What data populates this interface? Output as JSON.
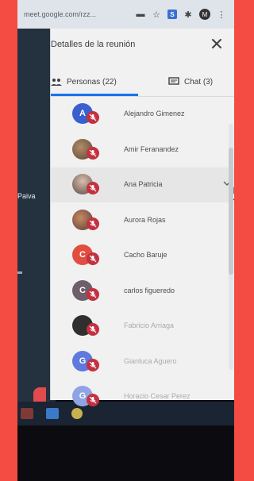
{
  "browser": {
    "url": "meet.google.com/rzz...",
    "extension_badge": "S",
    "profile_initial": "M"
  },
  "background": {
    "participant_label": "Paiva"
  },
  "panel": {
    "title": "Detalles de la reunión",
    "tabs": [
      {
        "label": "Personas (22)",
        "icon": "people-icon",
        "active": true
      },
      {
        "label": "Chat (3)",
        "icon": "chat-icon",
        "active": false
      }
    ],
    "people": [
      {
        "name": "Alejandro Gimenez",
        "initial": "A",
        "avatar_color": "#3a5fcf",
        "avatar_type": "initial",
        "muted": true
      },
      {
        "name": "Amir Feranandez",
        "initial": "",
        "avatar_color": "#8b6a4f",
        "avatar_type": "photo",
        "muted": true
      },
      {
        "name": "Ana Patricia",
        "initial": "",
        "avatar_color": "#c7b9b0",
        "avatar_type": "photo2",
        "muted": true,
        "hovered": true
      },
      {
        "name": "Aurora Rojas",
        "initial": "",
        "avatar_color": "#8a5a4a",
        "avatar_type": "photo3",
        "muted": true
      },
      {
        "name": "Cacho Baruje",
        "initial": "C",
        "avatar_color": "#e14e3f",
        "avatar_type": "initial",
        "muted": true
      },
      {
        "name": "carlos figueredo",
        "initial": "C",
        "avatar_color": "#6e5f6b",
        "avatar_type": "initial",
        "muted": true
      },
      {
        "name": "Fabricio Arriaga",
        "initial": "",
        "avatar_color": "#2f2f2f",
        "avatar_type": "black",
        "muted": true
      },
      {
        "name": "Gianluca Aguero",
        "initial": "G",
        "avatar_color": "#5f79de",
        "avatar_type": "initial",
        "muted": true
      },
      {
        "name": "Horacio Cesar Perez",
        "initial": "G",
        "avatar_color": "#8fa4e4",
        "avatar_type": "initial",
        "muted": true
      }
    ]
  },
  "colors": {
    "accent": "#1a73e8",
    "mic_muted": "#c3313f"
  }
}
